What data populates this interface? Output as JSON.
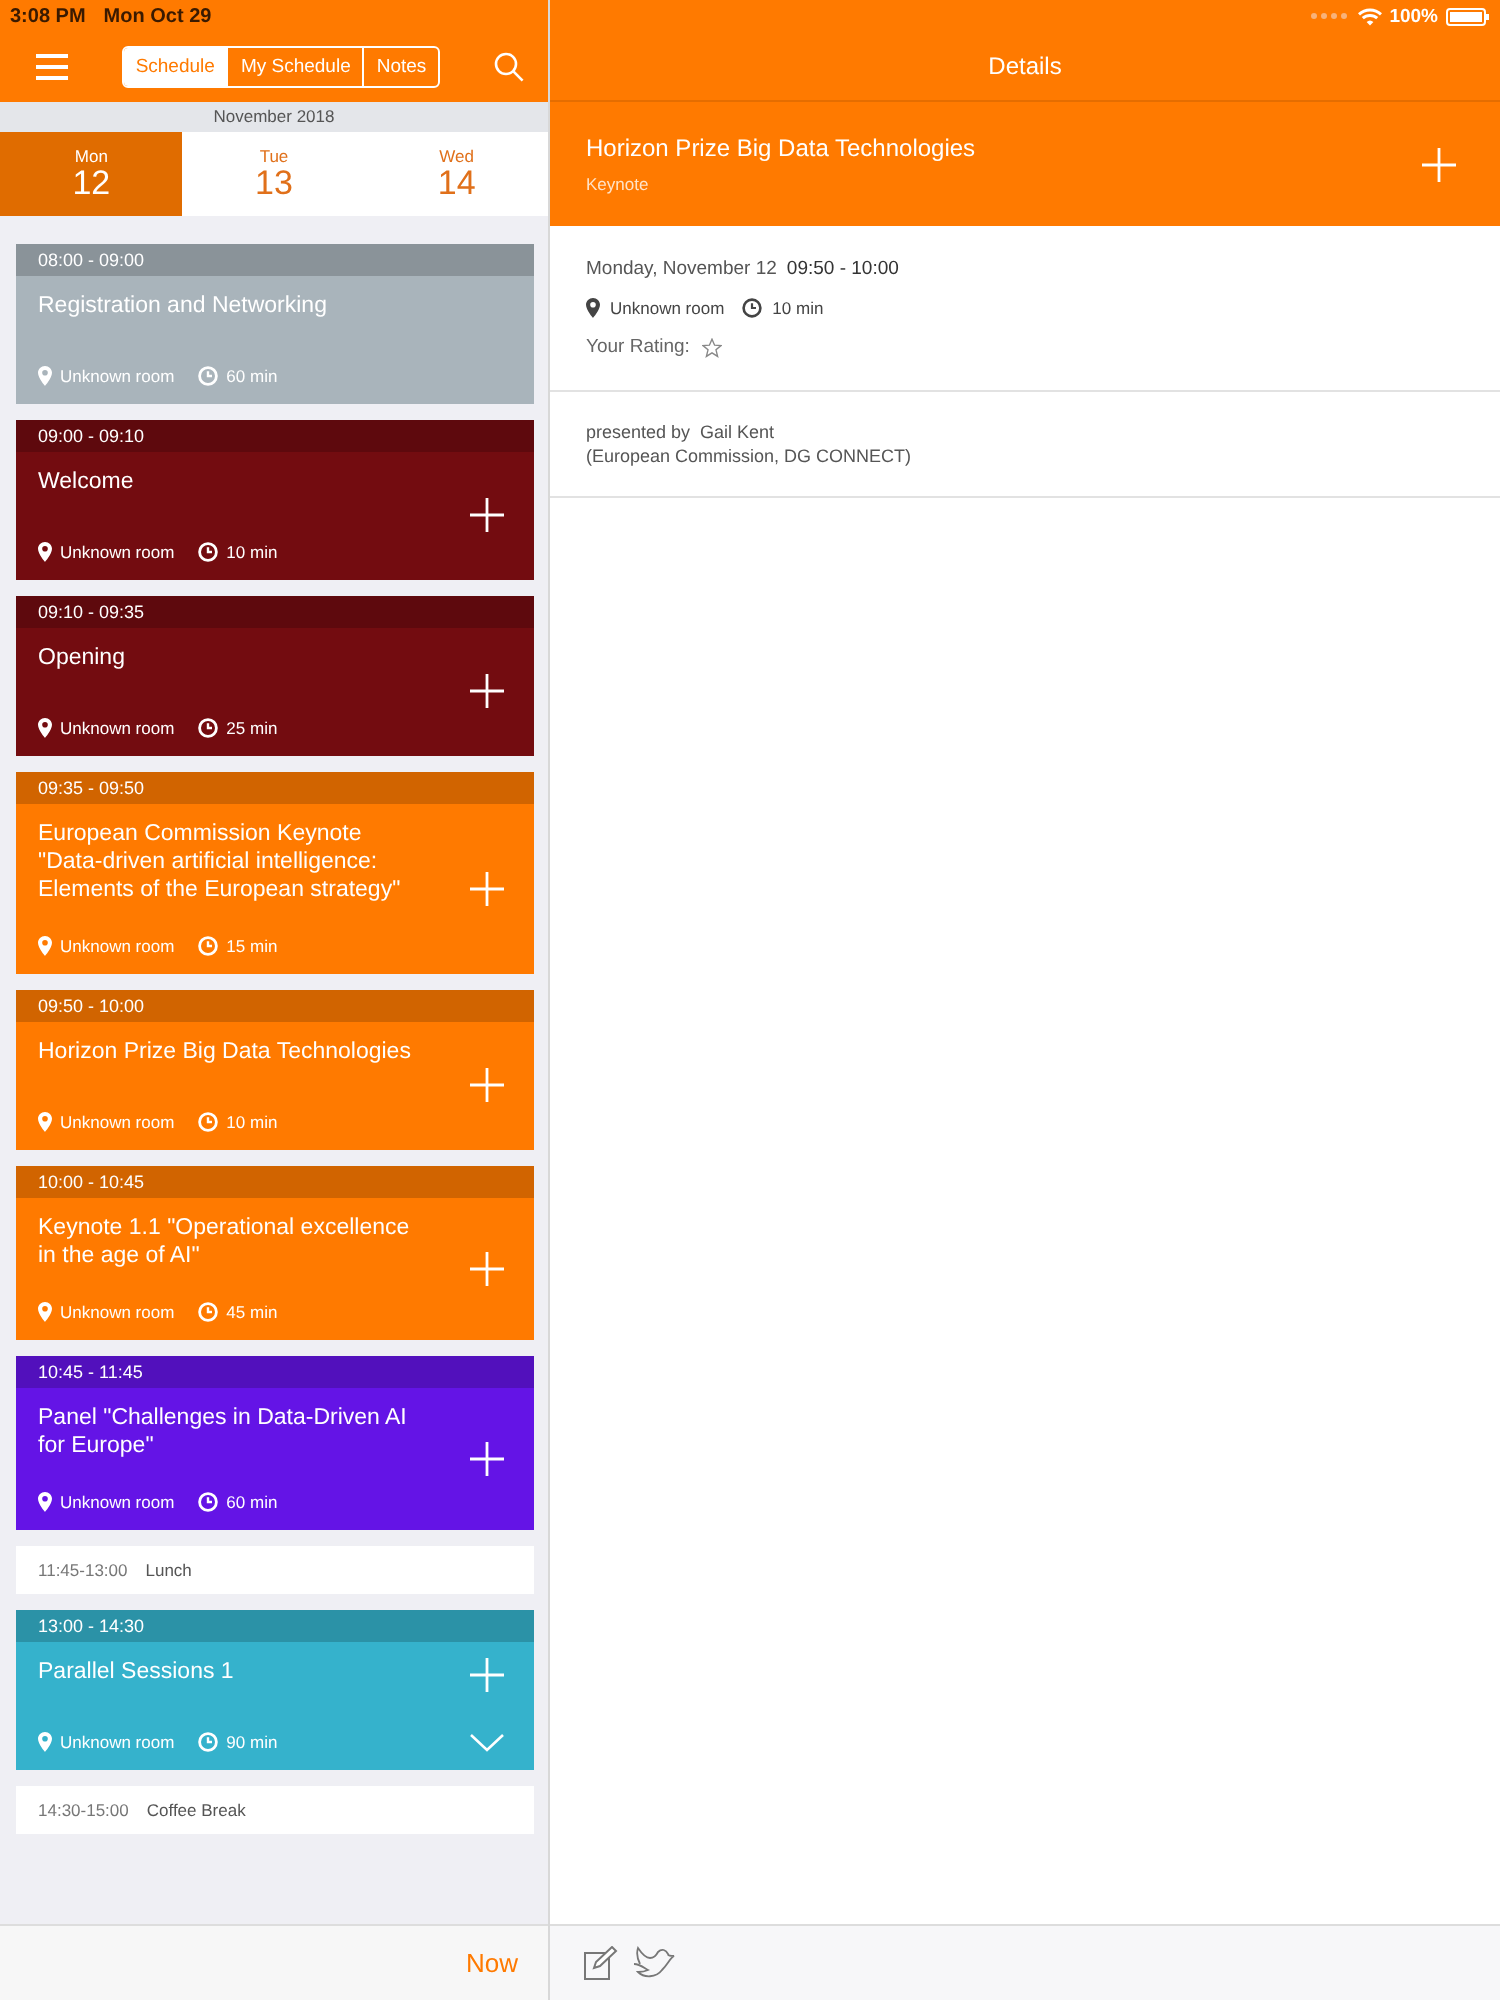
{
  "status_bar": {
    "time": "3:08 PM",
    "date": "Mon Oct 29",
    "battery": "100%"
  },
  "tabs": [
    {
      "label": "Schedule",
      "selected": true
    },
    {
      "label": "My Schedule",
      "selected": false
    },
    {
      "label": "Notes",
      "selected": false
    }
  ],
  "month": "November 2018",
  "days": [
    {
      "weekday": "Mon",
      "day": "12",
      "selected": true
    },
    {
      "weekday": "Tue",
      "day": "13",
      "selected": false
    },
    {
      "weekday": "Wed",
      "day": "14",
      "selected": false
    }
  ],
  "sessions": [
    {
      "kind": "session",
      "time": "08:00 - 09:00",
      "title": "Registration and Networking",
      "room": "Unknown room",
      "duration": "60 min",
      "color": "#a9b4bb",
      "addable": false,
      "expandable": false
    },
    {
      "kind": "session",
      "time": "09:00 - 09:10",
      "title": "Welcome",
      "room": "Unknown room",
      "duration": "10 min",
      "color": "#730c10",
      "addable": true,
      "expandable": false
    },
    {
      "kind": "session",
      "time": "09:10 - 09:35",
      "title": "Opening",
      "room": "Unknown room",
      "duration": "25 min",
      "color": "#730c10",
      "addable": true,
      "expandable": false
    },
    {
      "kind": "session",
      "time": "09:35 - 09:50",
      "title": "European Commission Keynote \"Data-driven artificial intelligence: Elements of the European strategy\"",
      "room": "Unknown room",
      "duration": "15 min",
      "color": "#ff7a00",
      "addable": true,
      "expandable": false
    },
    {
      "kind": "session",
      "time": "09:50 - 10:00",
      "title": "Horizon Prize Big Data Technologies",
      "room": "Unknown room",
      "duration": "10 min",
      "color": "#ff7a00",
      "addable": true,
      "expandable": false
    },
    {
      "kind": "session",
      "time": "10:00 - 10:45",
      "title": "Keynote 1.1 \"Operational excellence in the age of AI\"",
      "room": "Unknown room",
      "duration": "45 min",
      "color": "#ff7a00",
      "addable": true,
      "expandable": false
    },
    {
      "kind": "session",
      "time": "10:45 - 11:45",
      "title": "Panel \"Challenges in Data-Driven AI for Europe\"",
      "room": "Unknown room",
      "duration": "60 min",
      "color": "#6414e6",
      "addable": true,
      "expandable": false
    },
    {
      "kind": "break",
      "time": "11:45-13:00",
      "title": "Lunch"
    },
    {
      "kind": "session",
      "time": "13:00 - 14:30",
      "title": "Parallel Sessions 1",
      "room": "Unknown room",
      "duration": "90 min",
      "color": "#35b2cc",
      "addable": true,
      "expandable": true
    },
    {
      "kind": "break",
      "time": "14:30-15:00",
      "title": "Coffee Break"
    }
  ],
  "now_button": "Now",
  "details": {
    "title": "Details",
    "event_title": "Horizon Prize Big Data Technologies",
    "event_type": "Keynote",
    "date": "Monday, November 12",
    "time": "09:50 - 10:00",
    "room": "Unknown room",
    "duration": "10 min",
    "rating_label": "Your Rating:",
    "presented_by": "presented by",
    "presenter": "Gail Kent",
    "affiliation": "(European Commission, DG CONNECT)"
  }
}
